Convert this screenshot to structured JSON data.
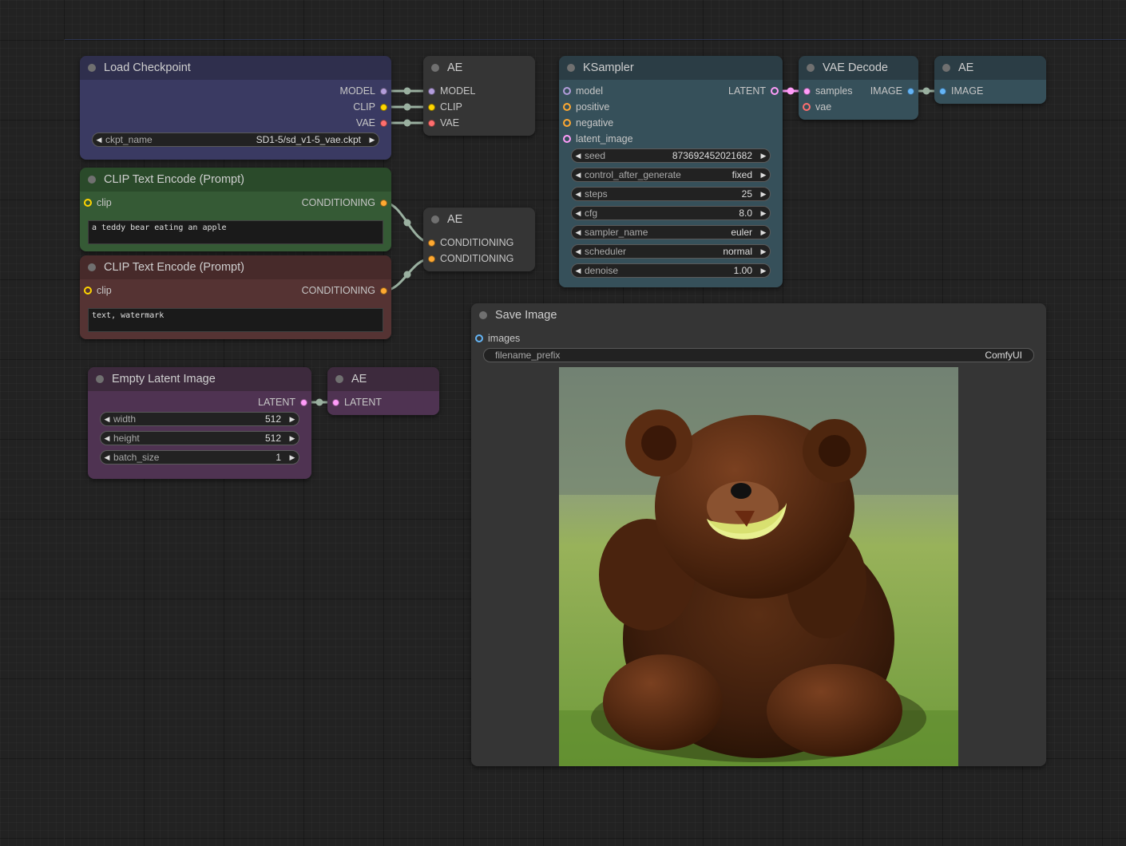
{
  "colors": {
    "model": "#b39ddb",
    "clip": "#ffd500",
    "vae": "#ff6e6e",
    "conditioning": "#ffa931",
    "latent": "#ff9cf9",
    "image": "#64b5f6",
    "link": "#9ab0a0"
  },
  "nodes": {
    "load_checkpoint": {
      "title": "Load Checkpoint",
      "outputs": [
        "MODEL",
        "CLIP",
        "VAE"
      ],
      "widget": {
        "label": "ckpt_name",
        "value": "SD1-5/sd_v1-5_vae.ckpt"
      }
    },
    "ae_1": {
      "title": "AE",
      "inputs": [
        "MODEL",
        "CLIP",
        "VAE"
      ]
    },
    "clip_pos": {
      "title": "CLIP Text Encode (Prompt)",
      "input": "clip",
      "output": "CONDITIONING",
      "text": "a teddy bear eating an apple"
    },
    "clip_neg": {
      "title": "CLIP Text Encode (Prompt)",
      "input": "clip",
      "output": "CONDITIONING",
      "text": "text, watermark"
    },
    "ae_2": {
      "title": "AE",
      "inputs": [
        "CONDITIONING",
        "CONDITIONING"
      ]
    },
    "ksampler": {
      "title": "KSampler",
      "inputs": [
        "model",
        "positive",
        "negative",
        "latent_image"
      ],
      "output": "LATENT",
      "widgets": [
        {
          "label": "seed",
          "value": "873692452021682"
        },
        {
          "label": "control_after_generate",
          "value": "fixed"
        },
        {
          "label": "steps",
          "value": "25"
        },
        {
          "label": "cfg",
          "value": "8.0"
        },
        {
          "label": "sampler_name",
          "value": "euler"
        },
        {
          "label": "scheduler",
          "value": "normal"
        },
        {
          "label": "denoise",
          "value": "1.00"
        }
      ]
    },
    "vae_decode": {
      "title": "VAE Decode",
      "inputs": [
        "samples",
        "vae"
      ],
      "output": "IMAGE"
    },
    "ae_3": {
      "title": "AE",
      "inputs": [
        "IMAGE"
      ]
    },
    "empty_latent": {
      "title": "Empty Latent Image",
      "output": "LATENT",
      "widgets": [
        {
          "label": "width",
          "value": "512"
        },
        {
          "label": "height",
          "value": "512"
        },
        {
          "label": "batch_size",
          "value": "1"
        }
      ]
    },
    "ae_4": {
      "title": "AE",
      "inputs": [
        "LATENT"
      ]
    },
    "save_image": {
      "title": "Save Image",
      "input": "images",
      "widget": {
        "label": "filename_prefix",
        "value": "ComfyUI"
      }
    }
  }
}
